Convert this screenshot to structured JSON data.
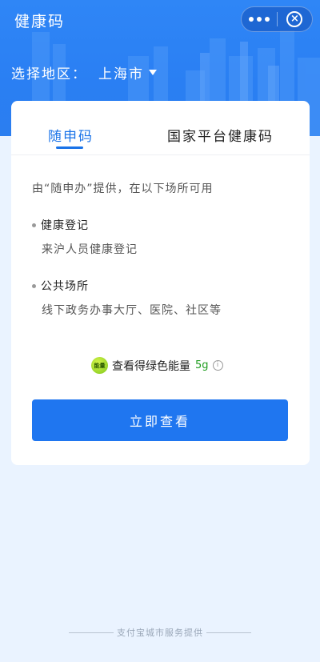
{
  "header": {
    "title": "健康码",
    "region_label": "选择地区：",
    "region_value": "上海市"
  },
  "tabs": [
    {
      "label": "随申码",
      "active": true
    },
    {
      "label": "国家平台健康码",
      "active": false
    }
  ],
  "content": {
    "intro": "由“随申办”提供，在以下场所可用",
    "sections": [
      {
        "title": "健康登记",
        "desc": "来沪人员健康登记"
      },
      {
        "title": "公共场所",
        "desc": "线下政务办事大厅、医院、社区等"
      }
    ],
    "energy": {
      "badge": "能量",
      "text": "查看得绿色能量",
      "amount": "5g"
    },
    "cta_label": "立即查看"
  },
  "footer": {
    "text": "支付宝城市服务提供"
  },
  "colors": {
    "header_blue": "#2f86f6",
    "accent": "#1a73e8",
    "button": "#1f76f0",
    "energy_green": "#1f9d1f"
  },
  "icons": [
    "more-icon",
    "close-icon",
    "caret-down-icon",
    "energy-badge-icon",
    "info-icon"
  ]
}
